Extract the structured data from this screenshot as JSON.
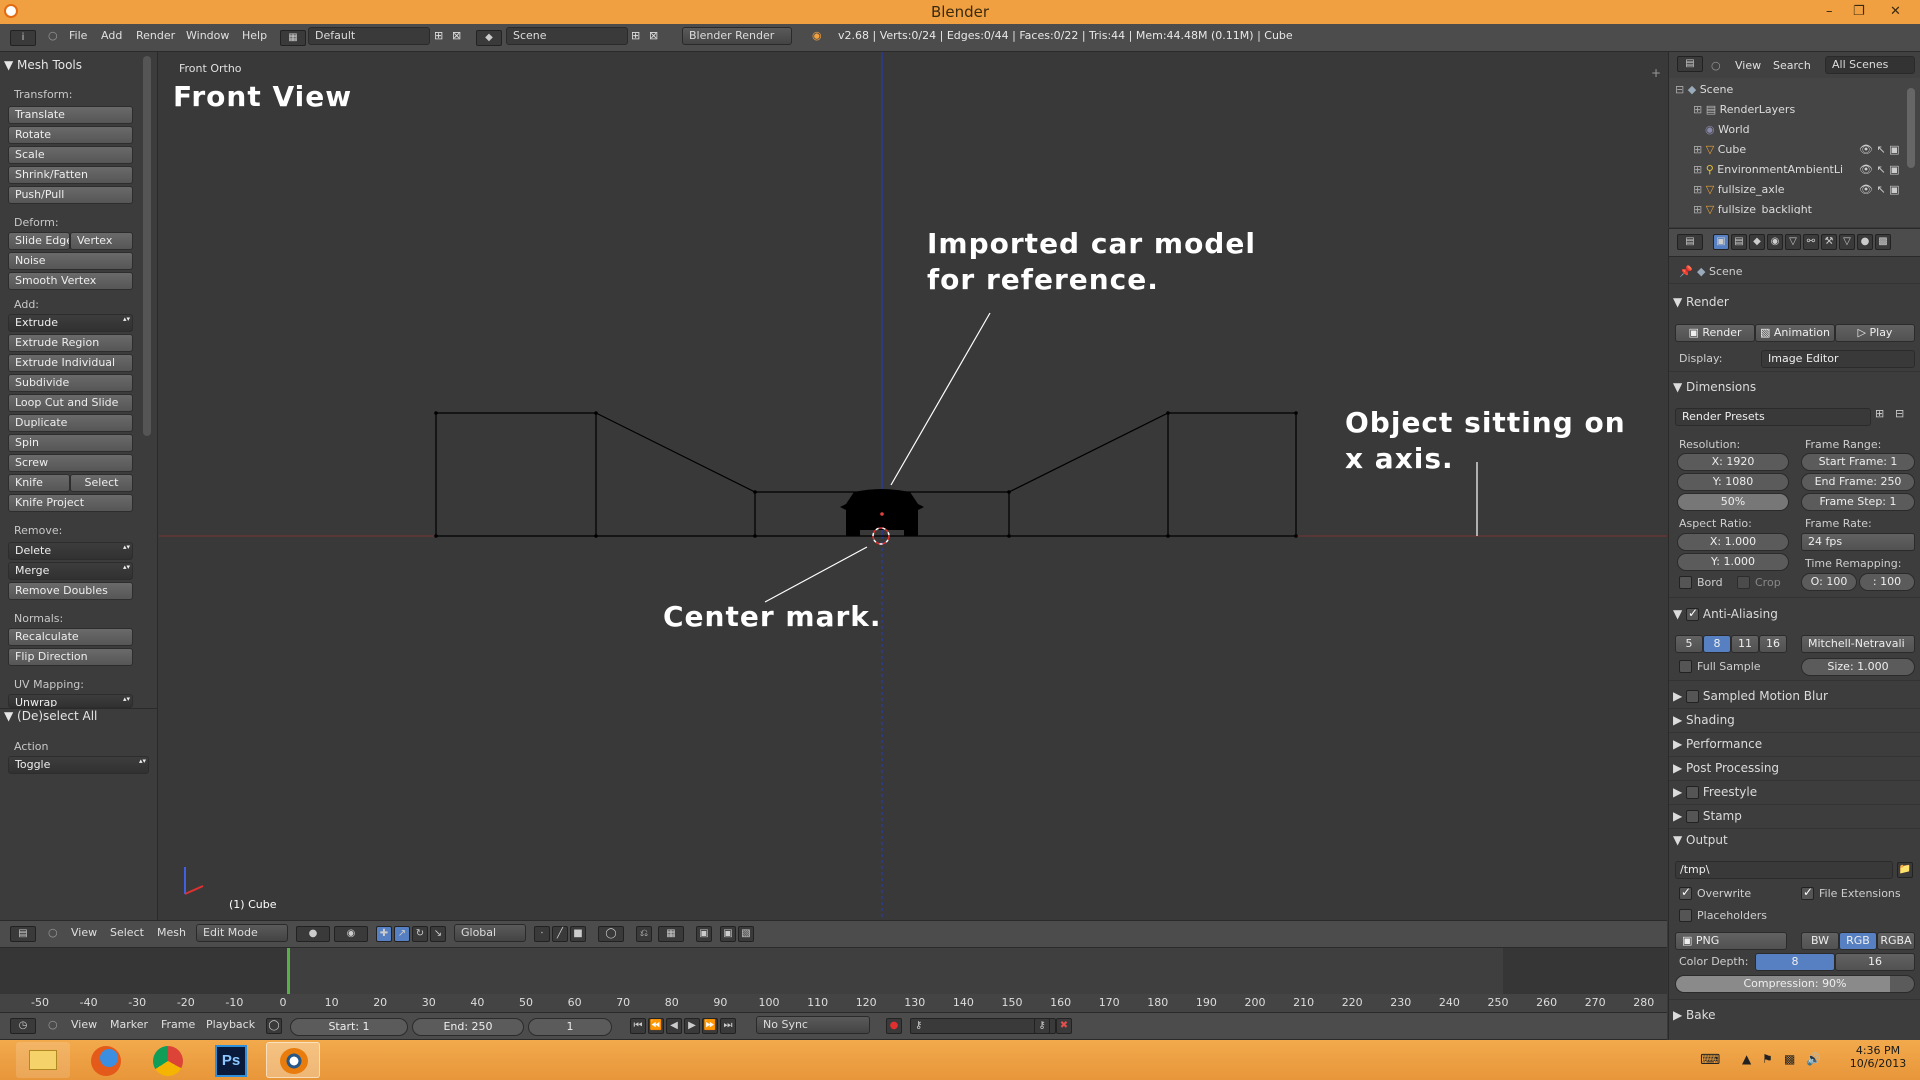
{
  "window": {
    "title": "Blender"
  },
  "info_header": {
    "menus": [
      "File",
      "Add",
      "Render",
      "Window",
      "Help"
    ],
    "layout": "Default",
    "scene": "Scene",
    "engine": "Blender Render",
    "stats": "v2.68 | Verts:0/24 | Edges:0/44 | Faces:0/22 | Tris:44 | Mem:44.48M (0.11M) | Cube"
  },
  "toolshelf": {
    "title": "Mesh Tools",
    "transform": {
      "label": "Transform:",
      "buttons": [
        "Translate",
        "Rotate",
        "Scale",
        "Shrink/Fatten",
        "Push/Pull"
      ]
    },
    "deform": {
      "label": "Deform:",
      "slide_edge": "Slide Edge",
      "vertex": "Vertex",
      "noise": "Noise",
      "smooth_vertex": "Smooth Vertex"
    },
    "add": {
      "label": "Add:",
      "extrude": "Extrude",
      "buttons": [
        "Extrude Region",
        "Extrude Individual",
        "Subdivide",
        "Loop Cut and Slide",
        "Duplicate",
        "Spin",
        "Screw"
      ],
      "knife": "Knife",
      "select": "Select",
      "knife_project": "Knife Project"
    },
    "remove": {
      "label": "Remove:",
      "delete": "Delete",
      "merge": "Merge",
      "remove_doubles": "Remove Doubles"
    },
    "normals": {
      "label": "Normals:",
      "recalculate": "Recalculate",
      "flip": "Flip Direction"
    },
    "uv": {
      "label": "UV Mapping:",
      "unwrap": "Unwrap"
    },
    "deselect": {
      "title": "(De)select All",
      "action_label": "Action",
      "action_value": "Toggle"
    }
  },
  "viewport": {
    "view_name": "Front Ortho",
    "object_info": "(1) Cube",
    "annotations": {
      "front_view": "Front View",
      "car_line1": "Imported car model",
      "car_line2": "for reference.",
      "axis_line1": "Object sitting on",
      "axis_line2": "x axis.",
      "center": "Center mark."
    }
  },
  "view3d_header": {
    "menus": [
      "View",
      "Select",
      "Mesh"
    ],
    "mode": "Edit Mode",
    "orientation": "Global"
  },
  "outliner": {
    "menus": [
      "View",
      "Search"
    ],
    "filter": "All Scenes",
    "items": [
      "Scene",
      "RenderLayers",
      "World",
      "Cube",
      "EnvironmentAmbientLi",
      "fullsize_axle",
      "fullsize_backlight"
    ]
  },
  "properties": {
    "context": "Scene",
    "render": {
      "title": "Render",
      "render_btn": "Render",
      "animation_btn": "Animation",
      "play_btn": "Play",
      "display_label": "Display:",
      "display_value": "Image Editor"
    },
    "dimensions": {
      "title": "Dimensions",
      "presets": "Render Presets",
      "resolution_label": "Resolution:",
      "res_x": "X: 1920",
      "res_y": "Y: 1080",
      "res_pct": "50%",
      "frame_range_label": "Frame Range:",
      "start": "Start Frame: 1",
      "end": "End Frame: 250",
      "step": "Frame Step: 1",
      "aspect_label": "Aspect Ratio:",
      "asp_x": "X: 1.000",
      "asp_y": "Y: 1.000",
      "framerate_label": "Frame Rate:",
      "fps": "24 fps",
      "time_remap_label": "Time Remapping:",
      "remap_old": "O: 100",
      "remap_new": ": 100",
      "border": "Bord",
      "crop": "Crop"
    },
    "aa": {
      "title": "Anti-Aliasing",
      "samples": [
        "5",
        "8",
        "11",
        "16"
      ],
      "filter": "Mitchell-Netravali",
      "full_sample": "Full Sample",
      "size": "Size: 1.000"
    },
    "panels": [
      "Sampled Motion Blur",
      "Shading",
      "Performance",
      "Post Processing",
      "Freestyle",
      "Stamp"
    ],
    "output": {
      "title": "Output",
      "path": "/tmp\\",
      "overwrite": "Overwrite",
      "file_ext": "File Extensions",
      "placeholders": "Placeholders",
      "format": "PNG",
      "bw": "BW",
      "rgb": "RGB",
      "rgba": "RGBA",
      "depth_label": "Color Depth:",
      "depth_8": "8",
      "depth_16": "16",
      "compression": "Compression: 90%"
    },
    "bake": "Bake"
  },
  "timeline": {
    "ticks": [
      "-50",
      "-40",
      "-30",
      "-20",
      "-10",
      "0",
      "10",
      "20",
      "30",
      "40",
      "50",
      "60",
      "70",
      "80",
      "90",
      "100",
      "110",
      "120",
      "130",
      "140",
      "150",
      "160",
      "170",
      "180",
      "190",
      "200",
      "210",
      "220",
      "230",
      "240",
      "250",
      "260",
      "270",
      "280"
    ],
    "menus": [
      "View",
      "Marker",
      "Frame",
      "Playback"
    ],
    "start": "Start: 1",
    "end": "End: 250",
    "current": "1",
    "sync": "No Sync"
  },
  "taskbar": {
    "time": "4:36 PM",
    "date": "10/6/2013"
  }
}
